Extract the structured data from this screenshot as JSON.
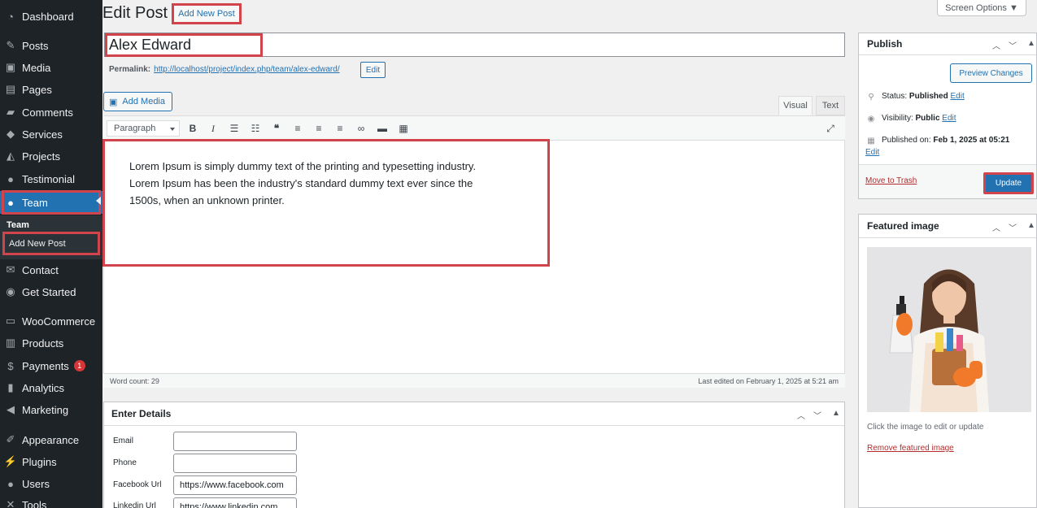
{
  "sidebar": {
    "items": [
      {
        "label": "Dashboard",
        "icon": "dashboard-icon",
        "glyph": "◔"
      },
      {
        "label": "Posts",
        "icon": "pin-icon",
        "glyph": "✎"
      },
      {
        "label": "Media",
        "icon": "media-icon",
        "glyph": "▣"
      },
      {
        "label": "Pages",
        "icon": "pages-icon",
        "glyph": "▤"
      },
      {
        "label": "Comments",
        "icon": "comments-icon",
        "glyph": "▰"
      },
      {
        "label": "Services",
        "icon": "tag-icon",
        "glyph": "◆"
      },
      {
        "label": "Projects",
        "icon": "graduation-icon",
        "glyph": "◭"
      },
      {
        "label": "Testimonial",
        "icon": "user-icon",
        "glyph": "●"
      },
      {
        "label": "Team",
        "icon": "team-icon",
        "glyph": "●"
      },
      {
        "label": "Contact",
        "icon": "mail-icon",
        "glyph": "✉"
      },
      {
        "label": "Get Started",
        "icon": "globe-icon",
        "glyph": "◉"
      },
      {
        "label": "WooCommerce",
        "icon": "woo-icon",
        "glyph": "▭"
      },
      {
        "label": "Products",
        "icon": "archive-icon",
        "glyph": "▥"
      },
      {
        "label": "Payments",
        "icon": "dollar-icon",
        "glyph": "$",
        "badge": "1"
      },
      {
        "label": "Analytics",
        "icon": "chart-icon",
        "glyph": "▮"
      },
      {
        "label": "Marketing",
        "icon": "megaphone-icon",
        "glyph": "◀"
      },
      {
        "label": "Appearance",
        "icon": "brush-icon",
        "glyph": "✐"
      },
      {
        "label": "Plugins",
        "icon": "plugin-icon",
        "glyph": "⚡"
      },
      {
        "label": "Users",
        "icon": "users-icon",
        "glyph": "●"
      },
      {
        "label": "Tools",
        "icon": "wrench-icon",
        "glyph": "✕"
      }
    ],
    "submenu": {
      "title": "Team",
      "item": "Add New Post"
    }
  },
  "header": {
    "title": "Edit Post",
    "add_new": "Add New Post",
    "screen_options": "Screen Options ▼"
  },
  "post": {
    "title": "Alex Edward",
    "permalink_label": "Permalink:",
    "permalink_url": "http://localhost/project/index.php/team/alex-edward/",
    "permalink_edit": "Edit"
  },
  "editor": {
    "add_media": "Add Media",
    "tab_visual": "Visual",
    "tab_text": "Text",
    "format": "Paragraph",
    "content": "Lorem Ipsum is simply dummy text of the printing and typesetting industry. Lorem Ipsum has been the industry's standard dummy text ever since the 1500s, when an unknown printer.",
    "word_count": "Word count: 29",
    "last_edited": "Last edited on February 1, 2025 at 5:21 am"
  },
  "details": {
    "title": "Enter Details",
    "fields": [
      {
        "label": "Email",
        "value": ""
      },
      {
        "label": "Phone",
        "value": ""
      },
      {
        "label": "Facebook Url",
        "value": "https://www.facebook.com"
      },
      {
        "label": "Linkedin Url",
        "value": "https://www.linkedin.com"
      }
    ]
  },
  "publish": {
    "title": "Publish",
    "preview": "Preview Changes",
    "status_label": "Status:",
    "status_value": "Published",
    "visibility_label": "Visibility:",
    "visibility_value": "Public",
    "published_label": "Published on:",
    "published_value": "Feb 1, 2025 at 05:21",
    "edit": "Edit",
    "trash": "Move to Trash",
    "update": "Update"
  },
  "featured": {
    "title": "Featured image",
    "hint": "Click the image to edit or update",
    "remove": "Remove featured image"
  },
  "colors": {
    "sidebar_bg": "#1d2327",
    "accent": "#2271b1",
    "highlight": "#d1444c"
  }
}
